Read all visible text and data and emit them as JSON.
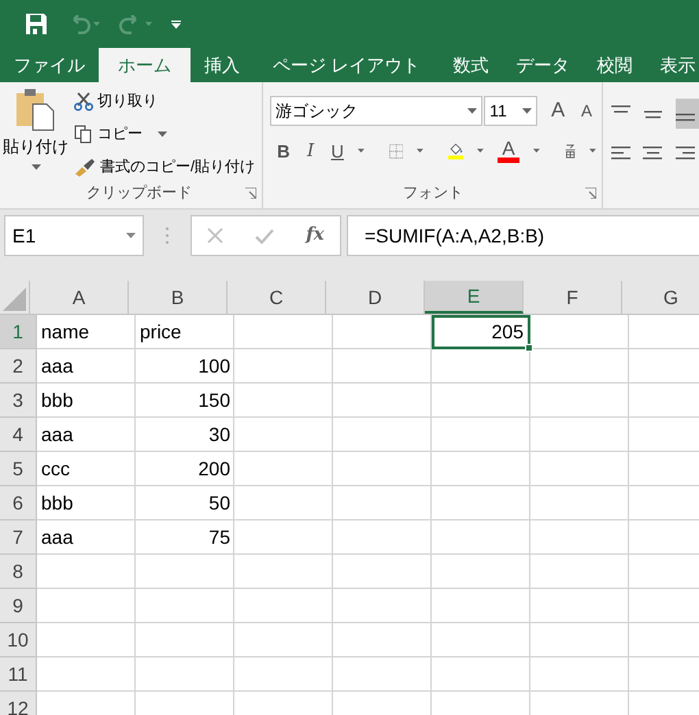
{
  "ribbon_tabs": [
    {
      "label": "ファイル",
      "selected": false
    },
    {
      "label": "ホーム",
      "selected": true
    },
    {
      "label": "挿入",
      "selected": false
    },
    {
      "label": "ページ レイアウト",
      "selected": false
    },
    {
      "label": "数式",
      "selected": false
    },
    {
      "label": "データ",
      "selected": false
    },
    {
      "label": "校閲",
      "selected": false
    },
    {
      "label": "表示",
      "selected": false
    }
  ],
  "clipboard": {
    "paste": "貼り付け",
    "cut": "切り取り",
    "copy": "コピー",
    "format_painter": "書式のコピー/貼り付け",
    "group_label": "クリップボード"
  },
  "font": {
    "name": "游ゴシック",
    "size": "11",
    "grow": "A",
    "shrink": "A",
    "bold": "B",
    "italic": "I",
    "underline": "U",
    "font_color_letter": "A",
    "group_label": "フォント"
  },
  "name_box": "E1",
  "fx": "fx",
  "formula": "=SUMIF(A:A,A2,B:B)",
  "columns": [
    {
      "label": "A",
      "selected": false
    },
    {
      "label": "B",
      "selected": false
    },
    {
      "label": "C",
      "selected": false
    },
    {
      "label": "D",
      "selected": false
    },
    {
      "label": "E",
      "selected": true
    },
    {
      "label": "F",
      "selected": false
    },
    {
      "label": "G",
      "selected": false
    }
  ],
  "rows": [
    {
      "header": "1",
      "selected": true,
      "cells": [
        {
          "text": "name",
          "kind": "text",
          "selected": false
        },
        {
          "text": "price",
          "kind": "text",
          "selected": false
        },
        null,
        null,
        {
          "text": "205",
          "kind": "number",
          "selected": true
        }
      ]
    },
    {
      "header": "2",
      "selected": false,
      "cells": [
        {
          "text": "aaa",
          "kind": "text",
          "selected": false
        },
        {
          "text": "100",
          "kind": "number",
          "selected": false
        }
      ]
    },
    {
      "header": "3",
      "selected": false,
      "cells": [
        {
          "text": "bbb",
          "kind": "text",
          "selected": false
        },
        {
          "text": "150",
          "kind": "number",
          "selected": false
        }
      ]
    },
    {
      "header": "4",
      "selected": false,
      "cells": [
        {
          "text": "aaa",
          "kind": "text",
          "selected": false
        },
        {
          "text": "30",
          "kind": "number",
          "selected": false
        }
      ]
    },
    {
      "header": "5",
      "selected": false,
      "cells": [
        {
          "text": "ccc",
          "kind": "text",
          "selected": false
        },
        {
          "text": "200",
          "kind": "number",
          "selected": false
        }
      ]
    },
    {
      "header": "6",
      "selected": false,
      "cells": [
        {
          "text": "bbb",
          "kind": "text",
          "selected": false
        },
        {
          "text": "50",
          "kind": "number",
          "selected": false
        }
      ]
    },
    {
      "header": "7",
      "selected": false,
      "cells": [
        {
          "text": "aaa",
          "kind": "text",
          "selected": false
        },
        {
          "text": "75",
          "kind": "number",
          "selected": false
        }
      ]
    },
    {
      "header": "8",
      "selected": false
    },
    {
      "header": "9",
      "selected": false
    },
    {
      "header": "10",
      "selected": false
    },
    {
      "header": "11",
      "selected": false
    },
    {
      "header": "12",
      "selected": false
    }
  ]
}
